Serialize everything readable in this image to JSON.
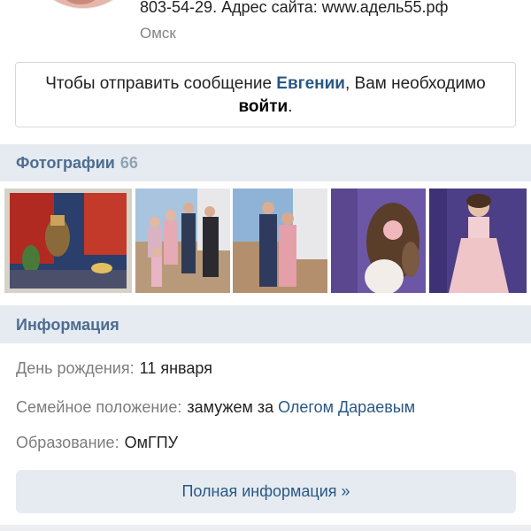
{
  "profile": {
    "contact_line": "803-54-29. Адрес сайта: www.адель55.рф",
    "city": "Омск"
  },
  "message_box": {
    "prefix": "Чтобы отправить сообщение ",
    "name": "Евгении",
    "middle": ", Вам необходимо",
    "login": "войти",
    "suffix": "."
  },
  "photos": {
    "title": "Фотографии",
    "count": "66"
  },
  "info": {
    "title": "Информация",
    "birthday_label": "День рождения:",
    "birthday_value": "11 января",
    "family_label": "Семейное положение:",
    "family_value": "замужем за",
    "family_link": "Олегом Дараевым",
    "education_label": "Образование:",
    "education_value": "ОмГПУ",
    "full_info_button": "Полная информация »"
  }
}
